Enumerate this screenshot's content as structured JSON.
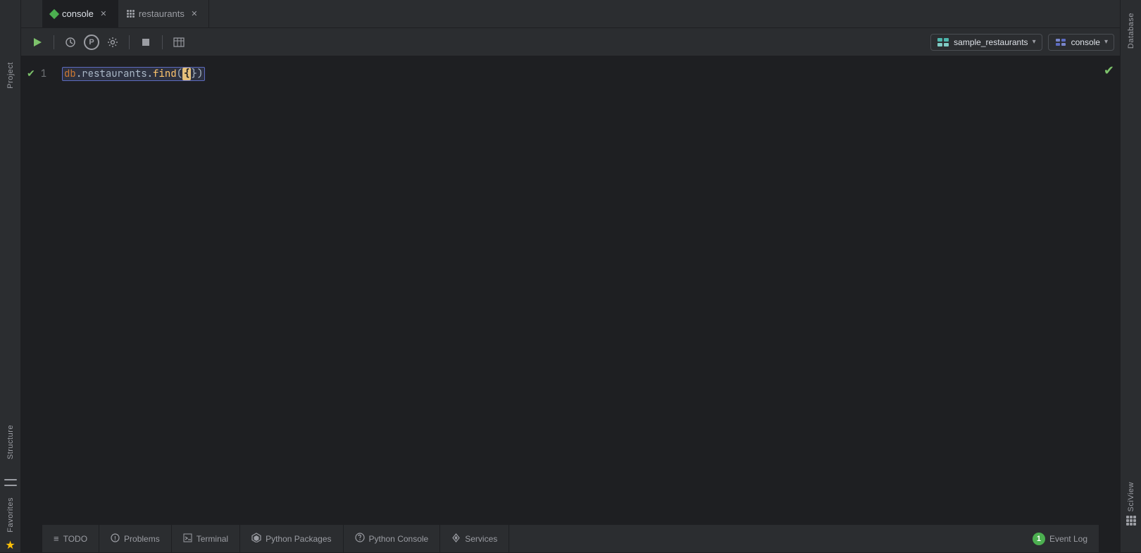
{
  "tabs": [
    {
      "id": "console",
      "label": "console",
      "icon": "green-diamond",
      "active": true
    },
    {
      "id": "restaurants",
      "label": "restaurants",
      "icon": "grid",
      "active": false
    }
  ],
  "toolbar": {
    "run_label": "▶",
    "history_label": "⏱",
    "package_label": "P",
    "settings_label": "🔧",
    "stop_label": "◼",
    "table_label": "⊞",
    "db_selector": "sample_restaurants",
    "console_selector": "console",
    "chevron": "▾"
  },
  "editor": {
    "line_number": "1",
    "code": "db.restaurants.find({{})",
    "code_parts": {
      "db": "db",
      "dot1": ".",
      "collection": "restaurants",
      "dot2": ".",
      "method": "find",
      "open_paren": "(",
      "open_brace": "{",
      "close_brace": "}",
      "close_paren": ")"
    }
  },
  "sidebar_left": {
    "items": [
      "Project",
      "Structure",
      "Favorites"
    ]
  },
  "sidebar_right": {
    "items": [
      "Database",
      "SciView"
    ]
  },
  "bottom_bar": {
    "items": [
      {
        "id": "todo",
        "icon": "≡",
        "label": "TODO"
      },
      {
        "id": "problems",
        "icon": "⚠",
        "label": "Problems"
      },
      {
        "id": "terminal",
        "icon": "▶",
        "label": "Terminal"
      },
      {
        "id": "python-packages",
        "icon": "⬡",
        "label": "Python Packages"
      },
      {
        "id": "python-console",
        "icon": "🐍",
        "label": "Python Console"
      },
      {
        "id": "services",
        "icon": "▶",
        "label": "Services"
      }
    ],
    "event_log": {
      "badge_count": "1",
      "label": "Event Log"
    }
  }
}
